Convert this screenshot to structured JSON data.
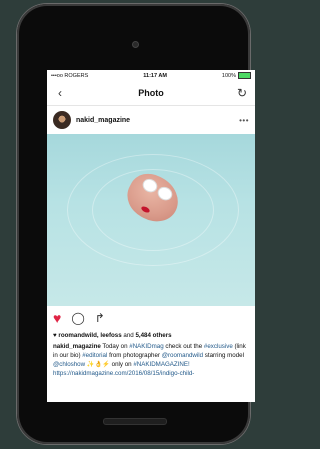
{
  "status_bar": {
    "carrier": "•••oo ROGERS",
    "time": "11:17 AM",
    "battery": "100%"
  },
  "nav": {
    "title": "Photo",
    "back_icon": "back-chevron-icon",
    "refresh_icon": "refresh-icon"
  },
  "post": {
    "username": "nakid_magazine",
    "more": "•••",
    "likes_text_users": "roomandwild, leefoss",
    "likes_text_and": " and ",
    "likes_text_count": "5,484 others",
    "caption": {
      "user": "nakid_magazine",
      "t1": " Today on ",
      "h1": "#NAKIDmag",
      "t2": " check out the ",
      "h2": "#exclusive",
      "t3": " (link in our bio) ",
      "h3": "#editorial",
      "t4": " from photographer ",
      "h4": "@roomandwild",
      "t5": " starring model ",
      "h5": "@chloshow",
      "t6": " ✨👌⚡ only on ",
      "h6": "#NAKIDMAGAZINE!",
      "link": "https://nakidmagazine.com/2016/08/15/indigo-child-"
    }
  },
  "colors": {
    "heart": "#e02445",
    "hashtag": "#235a8a",
    "background": "#2e3d3a"
  }
}
